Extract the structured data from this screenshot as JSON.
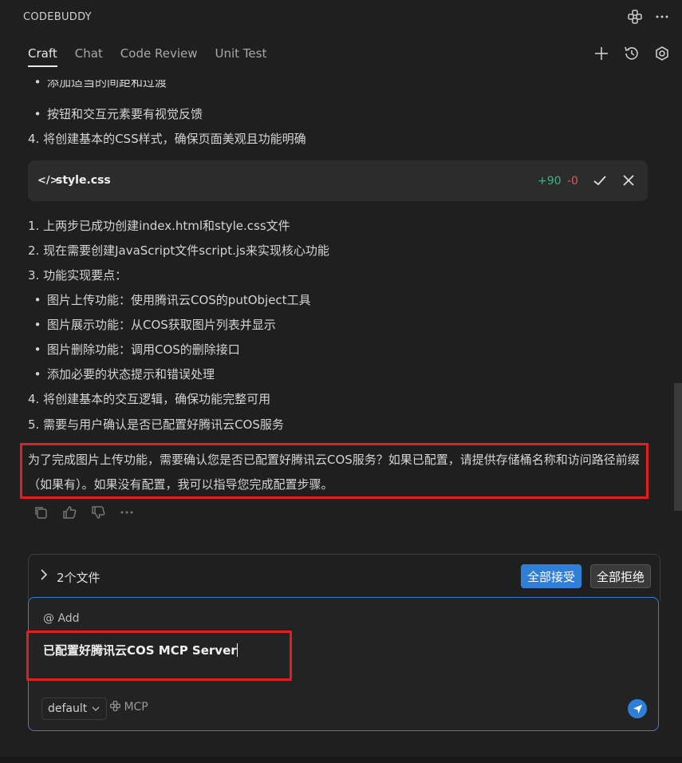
{
  "app": {
    "title": "CODEBUDDY"
  },
  "tabs": [
    "Craft",
    "Chat",
    "Code Review",
    "Unit Test"
  ],
  "messages": {
    "cut_line": "添加适当的间距和过渡",
    "lines_before_card": [
      "按钮和交互元素要有视觉反馈",
      "4. 将创建基本的CSS样式，确保页面美观且功能明确"
    ],
    "file_card": {
      "name": "style.css",
      "additions": "+90",
      "deletions": "-0"
    },
    "plan": [
      "1. 上两步已成功创建index.html和style.css文件",
      "2. 现在需要创建JavaScript文件script.js来实现核心功能",
      "3. 功能实现要点：",
      "图片上传功能：使用腾讯云COS的putObject工具",
      "图片展示功能：从COS获取图片列表并显示",
      "图片删除功能：调用COS的删除接口",
      "添加必要的状态提示和错误处理",
      "4. 将创建基本的交互逻辑，确保功能完整可用",
      "5. 需要与用户确认是否已配置好腾讯云COS服务"
    ],
    "question": "为了完成图片上传功能，需要确认您是否已配置好腾讯云COS服务？如果已配置，请提供存储桶名称和访问路径前缀（如果有）。如果没有配置，我可以指导您完成配置步骤。"
  },
  "files_bar": {
    "label": "2个文件",
    "accept_all": "全部接受",
    "reject_all": "全部拒绝"
  },
  "input": {
    "add_context": "@ Add",
    "value": "已配置好腾讯云COS MCP Server",
    "mode": "default",
    "mcp_label": "MCP"
  },
  "colors": {
    "accent": "#2f7ed8",
    "highlight": "#e02020",
    "added": "#3fb37f",
    "deleted": "#e05a5a"
  }
}
